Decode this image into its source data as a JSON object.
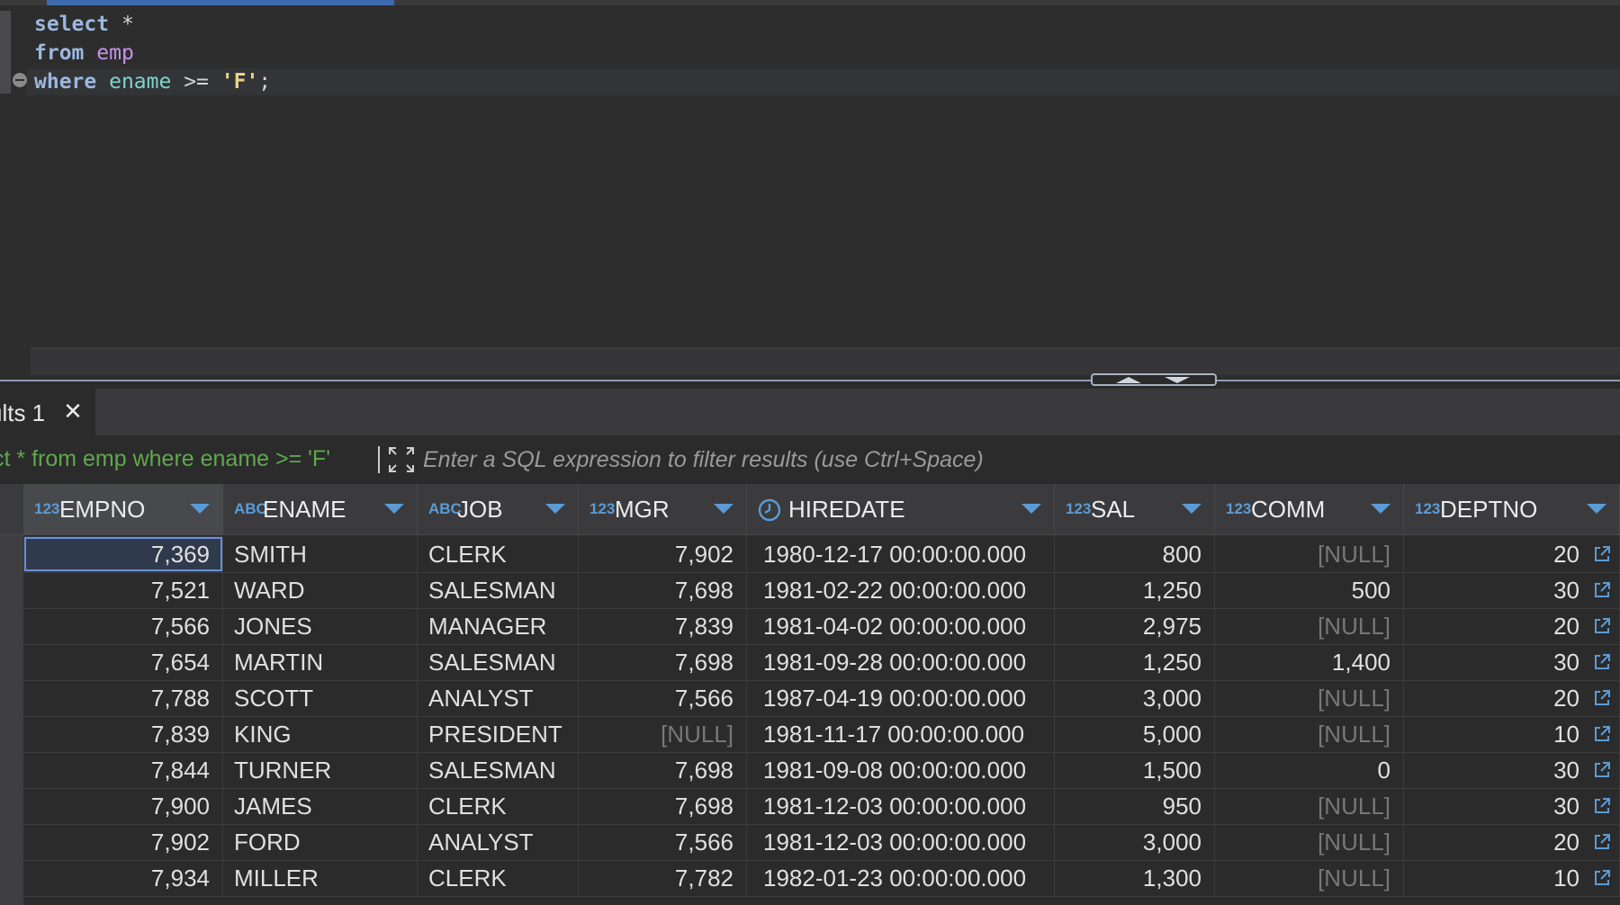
{
  "editor": {
    "lines": [
      {
        "kw": "select",
        "rest": " *"
      },
      {
        "kw": "from",
        "table": "emp"
      },
      {
        "kw": "where",
        "column": "ename",
        "op": " >= ",
        "literal": "'F'",
        "end": ";"
      }
    ]
  },
  "results_tab": {
    "label": "ults 1",
    "close": "✕"
  },
  "filter": {
    "query_text": "ct * from emp where ename >= 'F'",
    "placeholder": "Enter a SQL expression to filter results (use Ctrl+Space)"
  },
  "grid": {
    "columns": [
      {
        "type": "123",
        "name": "EMPNO"
      },
      {
        "type": "ABC",
        "name": "ENAME"
      },
      {
        "type": "ABC",
        "name": "JOB"
      },
      {
        "type": "123",
        "name": "MGR"
      },
      {
        "type": "clock-icon",
        "name": "HIREDATE"
      },
      {
        "type": "123",
        "name": "SAL"
      },
      {
        "type": "123",
        "name": "COMM"
      },
      {
        "type": "123",
        "name": "DEPTNO"
      }
    ],
    "rows": [
      [
        "7,369",
        "SMITH",
        "CLERK",
        "7,902",
        "1980-12-17 00:00:00.000",
        "800",
        "[NULL]",
        "20"
      ],
      [
        "7,521",
        "WARD",
        "SALESMAN",
        "7,698",
        "1981-02-22 00:00:00.000",
        "1,250",
        "500",
        "30"
      ],
      [
        "7,566",
        "JONES",
        "MANAGER",
        "7,839",
        "1981-04-02 00:00:00.000",
        "2,975",
        "[NULL]",
        "20"
      ],
      [
        "7,654",
        "MARTIN",
        "SALESMAN",
        "7,698",
        "1981-09-28 00:00:00.000",
        "1,250",
        "1,400",
        "30"
      ],
      [
        "7,788",
        "SCOTT",
        "ANALYST",
        "7,566",
        "1987-04-19 00:00:00.000",
        "3,000",
        "[NULL]",
        "20"
      ],
      [
        "7,839",
        "KING",
        "PRESIDENT",
        "[NULL]",
        "1981-11-17 00:00:00.000",
        "5,000",
        "[NULL]",
        "10"
      ],
      [
        "7,844",
        "TURNER",
        "SALESMAN",
        "7,698",
        "1981-09-08 00:00:00.000",
        "1,500",
        "0",
        "30"
      ],
      [
        "7,900",
        "JAMES",
        "CLERK",
        "7,698",
        "1981-12-03 00:00:00.000",
        "950",
        "[NULL]",
        "30"
      ],
      [
        "7,902",
        "FORD",
        "ANALYST",
        "7,566",
        "1981-12-03 00:00:00.000",
        "3,000",
        "[NULL]",
        "20"
      ],
      [
        "7,934",
        "MILLER",
        "CLERK",
        "7,782",
        "1982-01-23 00:00:00.000",
        "1,300",
        "[NULL]",
        "10"
      ]
    ]
  },
  "colors": {
    "accent": "#5b9bd5",
    "keyword": "#9bb8e0",
    "table": "#c792ea",
    "column": "#7fd3cf",
    "string": "#e8d38a",
    "query_green": "#5fa84d"
  }
}
